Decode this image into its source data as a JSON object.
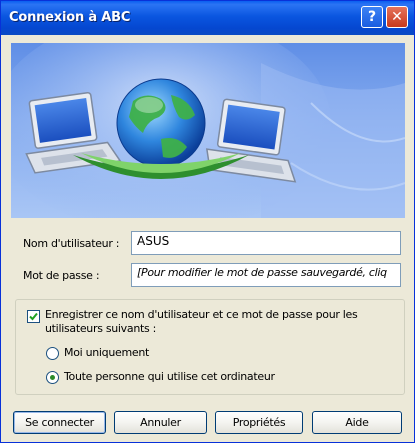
{
  "window": {
    "title": "Connexion à ABC",
    "help_label": "?",
    "close_label": "✕"
  },
  "form": {
    "username_label": "Nom d'utilisateur :",
    "username_value": "ASUS",
    "password_label": "Mot de passe :",
    "password_value": "[Pour modifier le mot de passe sauvegardé, cliq"
  },
  "save": {
    "checkbox_label": "Enregistrer ce nom d'utilisateur et ce mot de passe pour les utilisateurs suivants :",
    "checked": true,
    "option_me": "Moi uniquement",
    "option_everyone": "Toute personne qui utilise cet ordinateur",
    "selected": "everyone"
  },
  "buttons": {
    "connect": "Se connecter",
    "cancel": "Annuler",
    "properties": "Propriétés",
    "help": "Aide"
  },
  "colors": {
    "titlebar": "#0a56e0",
    "face": "#ece9d8",
    "banner": "#86acef"
  }
}
